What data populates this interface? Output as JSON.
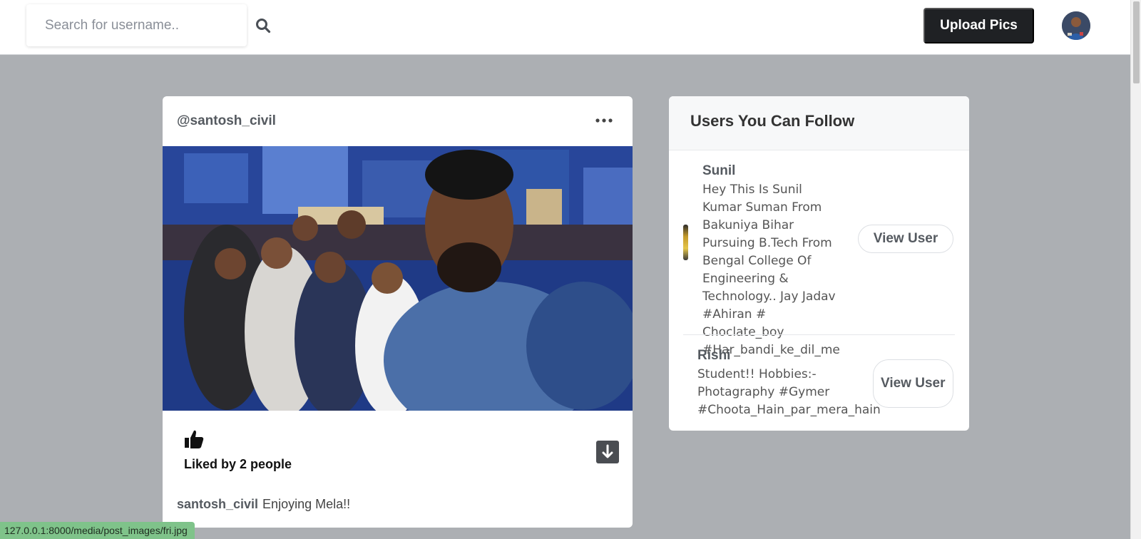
{
  "navbar": {
    "search_placeholder": "Search for username..",
    "upload_label": "Upload Pics"
  },
  "post": {
    "username": "@santosh_civil",
    "liked_by": "Liked by 2 people",
    "caption_user": "santosh_civil",
    "caption_text": "Enjoying Mela!!"
  },
  "follow_panel": {
    "title": "Users You Can Follow",
    "users": [
      {
        "name": "Sunil",
        "bio": "Hey This Is Sunil Kumar Suman From Bakuniya Bihar Pursuing B.Tech From Bengal College Of Engineering & Technology.. Jay Jadav #Ahiran # Choclate_boy #Har_bandi_ke_dil_me",
        "button": "View User"
      },
      {
        "name": "Rishi",
        "bio": "Student!! Hobbies:- Photagraphy #Gymer #Choota_Hain_par_mera_hain",
        "button": "View User"
      }
    ]
  },
  "status_bar": {
    "url": "127.0.0.1:8000/media/post_images/fri.jpg"
  },
  "colors": {
    "page_background": "#acafb3",
    "upload_button": "#1f2124",
    "status_bar": "#7fc38a"
  },
  "icons": [
    "search-icon",
    "more-horizontal-icon",
    "thumbs-up-icon",
    "download-icon"
  ]
}
